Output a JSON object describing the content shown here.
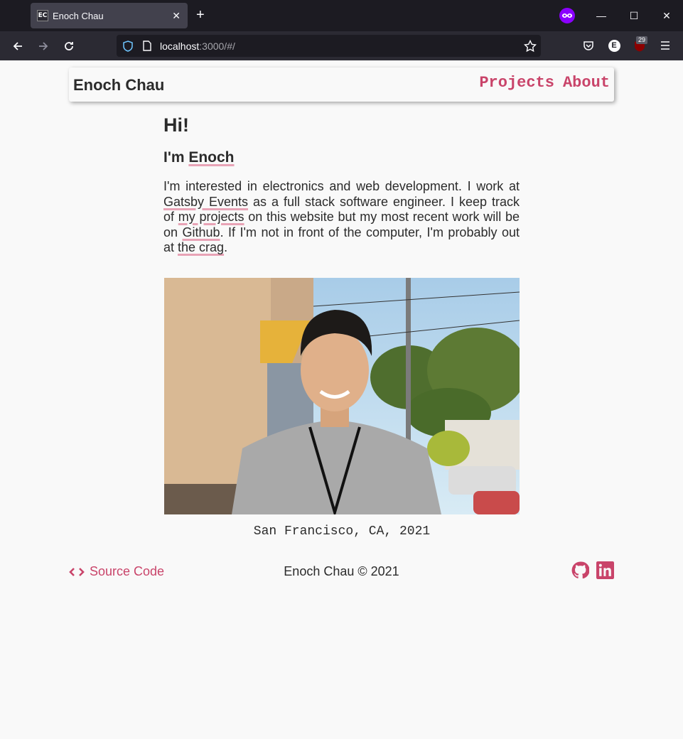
{
  "browser": {
    "tab_title": "Enoch Chau",
    "tab_favicon": "EC",
    "url_host": "localhost",
    "url_rest": ":3000/#/",
    "extension_badge": "29"
  },
  "header": {
    "site_name": "Enoch Chau",
    "nav": [
      "Projects",
      "About"
    ]
  },
  "content": {
    "greeting": "Hi!",
    "intro_prefix": "I'm ",
    "intro_name": "Enoch",
    "bio": {
      "t1": "I'm interested in electronics and web development. I work at ",
      "link1": "Gatsby Events",
      "t2": " as a full stack software engineer. I keep track of ",
      "link2": "my projects",
      "t3": " on this website but my most recent work will be on ",
      "link3": "Github",
      "t4": ". If I'm not in front of the computer, I'm probably out at ",
      "link4": "the crag",
      "t5": "."
    },
    "photo_caption": "San Francisco, CA, 2021"
  },
  "footer": {
    "source_label": "Source Code",
    "copyright": "Enoch Chau © 2021"
  },
  "colors": {
    "accent": "#c9446a",
    "underline": "#e8a3b6",
    "background": "#f9f9f9",
    "text": "#2b2b2b"
  }
}
